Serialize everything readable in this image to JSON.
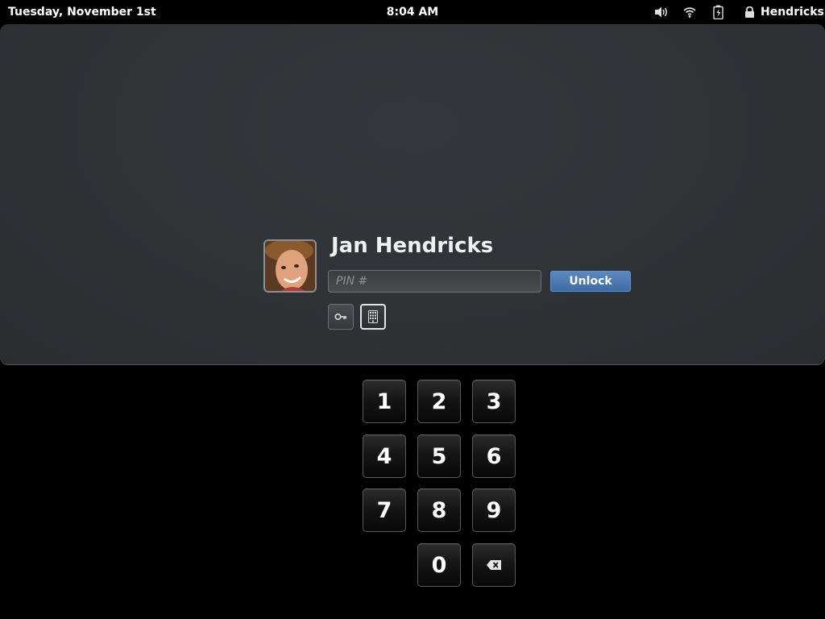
{
  "topbar": {
    "date": "Tuesday, November 1st",
    "time": "8:04 AM",
    "user": "Hendricks",
    "icons": [
      "volume-icon",
      "wifi-icon",
      "battery-icon",
      "lock-icon"
    ]
  },
  "login": {
    "name": "Jan Hendricks",
    "pin_placeholder": "PIN #",
    "pin_value": "",
    "unlock_label": "Unlock",
    "auth_methods": [
      "key-icon",
      "keypad-icon"
    ]
  },
  "keypad": {
    "keys": [
      "1",
      "2",
      "3",
      "4",
      "5",
      "6",
      "7",
      "8",
      "9",
      "0"
    ],
    "backspace_icon": "backspace-icon"
  },
  "colors": {
    "panel": "#2f3336",
    "accent": "#4a78b0",
    "background": "#000000"
  }
}
